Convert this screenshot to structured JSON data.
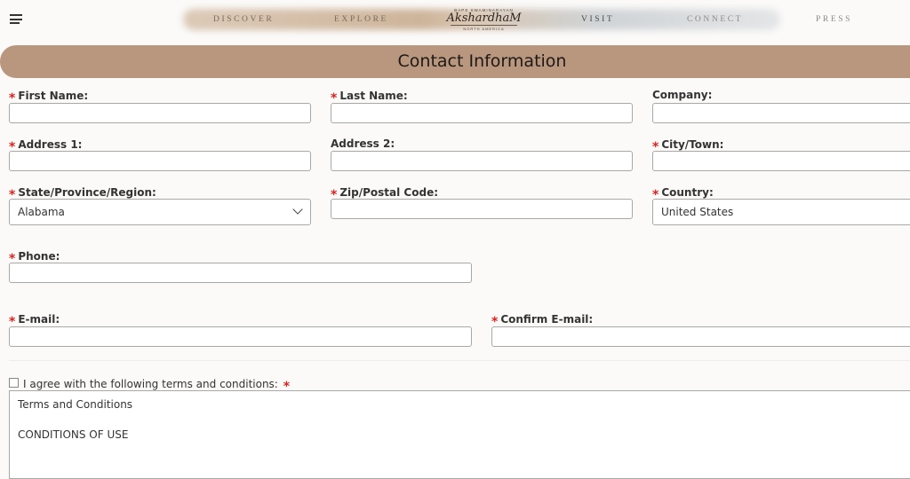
{
  "nav": {
    "items": [
      "DISCOVER",
      "EXPLORE",
      "VISIT",
      "CONNECT",
      "PRESS"
    ],
    "logo": {
      "top_text": "BAPS SWAMINARAYAN",
      "main_text": "AkshardhaM",
      "bottom_text": "NORTH AMERICA"
    }
  },
  "section": {
    "title": "Contact Information"
  },
  "form": {
    "required_mark": "*",
    "first_name": {
      "label": "First Name:",
      "value": ""
    },
    "last_name": {
      "label": "Last Name:",
      "value": ""
    },
    "company": {
      "label": "Company:",
      "value": ""
    },
    "address1": {
      "label": "Address 1:",
      "value": ""
    },
    "address2": {
      "label": "Address 2:",
      "value": ""
    },
    "city": {
      "label": "City/Town:",
      "value": ""
    },
    "state": {
      "label": "State/Province/Region:",
      "value": "Alabama"
    },
    "zip": {
      "label": "Zip/Postal Code:",
      "value": ""
    },
    "country": {
      "label": "Country:",
      "value": "United States"
    },
    "phone": {
      "label": "Phone:",
      "value": ""
    },
    "email": {
      "label": "E-mail:",
      "value": ""
    },
    "confirm_email": {
      "label": "Confirm E-mail:",
      "value": ""
    },
    "agree": {
      "label": "I agree with the following terms and conditions:",
      "checked": false
    },
    "terms": {
      "heading": "Terms and Conditions",
      "subheading": "CONDITIONS OF USE"
    }
  },
  "colors": {
    "banner": "#b9977e",
    "required": "#e0201b",
    "background": "#fbfaf9"
  }
}
